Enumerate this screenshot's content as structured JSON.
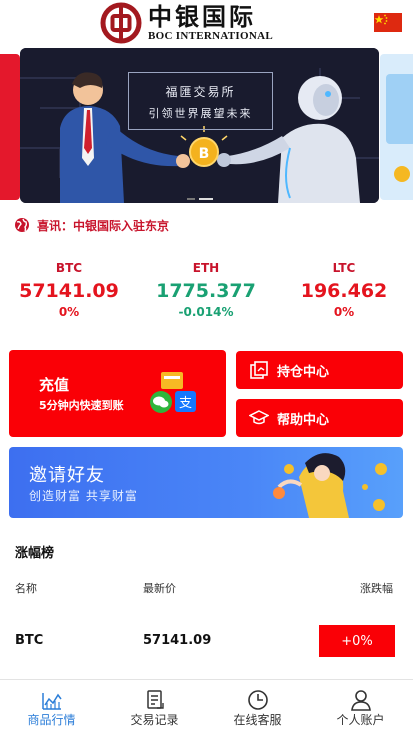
{
  "header": {
    "logo_cn": "中银国际",
    "logo_en": "BOC INTERNATIONAL",
    "flag_icon": "china-flag-icon"
  },
  "banner": {
    "line1": "福匯交易所",
    "line2": "引领世界展望未来",
    "slide_count": 2,
    "active_slide": 1
  },
  "notice": {
    "label": "喜讯：",
    "text": "中银国际入驻东京"
  },
  "tickers": [
    {
      "symbol": "BTC",
      "price": "57141.09",
      "change": "0%",
      "color": "#e4141e"
    },
    {
      "symbol": "ETH",
      "price": "1775.377",
      "change": "-0.014%",
      "color": "#1aa173"
    },
    {
      "symbol": "LTC",
      "price": "196.462",
      "change": "0%",
      "color": "#e4141e"
    }
  ],
  "actions": {
    "recharge_title": "充值",
    "recharge_sub": "5分钟内快速到账",
    "position_label": "持仓中心",
    "help_label": "帮助中心",
    "pay_icons": [
      "card-icon",
      "wechat-pay-icon",
      "alipay-icon"
    ]
  },
  "invite": {
    "title": "邀请好友",
    "subtitle": "创造财富 共享财富"
  },
  "ranking": {
    "title": "涨幅榜",
    "col_name": "名称",
    "col_price": "最新价",
    "col_change": "涨跌幅",
    "rows": [
      {
        "symbol": "BTC",
        "price": "57141.09",
        "change": "+0%"
      }
    ]
  },
  "tabs": [
    {
      "label": "商品行情",
      "icon": "chart-icon",
      "active": true
    },
    {
      "label": "交易记录",
      "icon": "document-icon",
      "active": false
    },
    {
      "label": "在线客服",
      "icon": "clock-icon",
      "active": false
    },
    {
      "label": "个人账户",
      "icon": "user-icon",
      "active": false
    }
  ],
  "colors": {
    "brand_red": "#fa0006",
    "up_red": "#e4141e",
    "down_green": "#1aa173",
    "active_tab": "#2c7ed8",
    "notice_red": "#c8142c"
  }
}
